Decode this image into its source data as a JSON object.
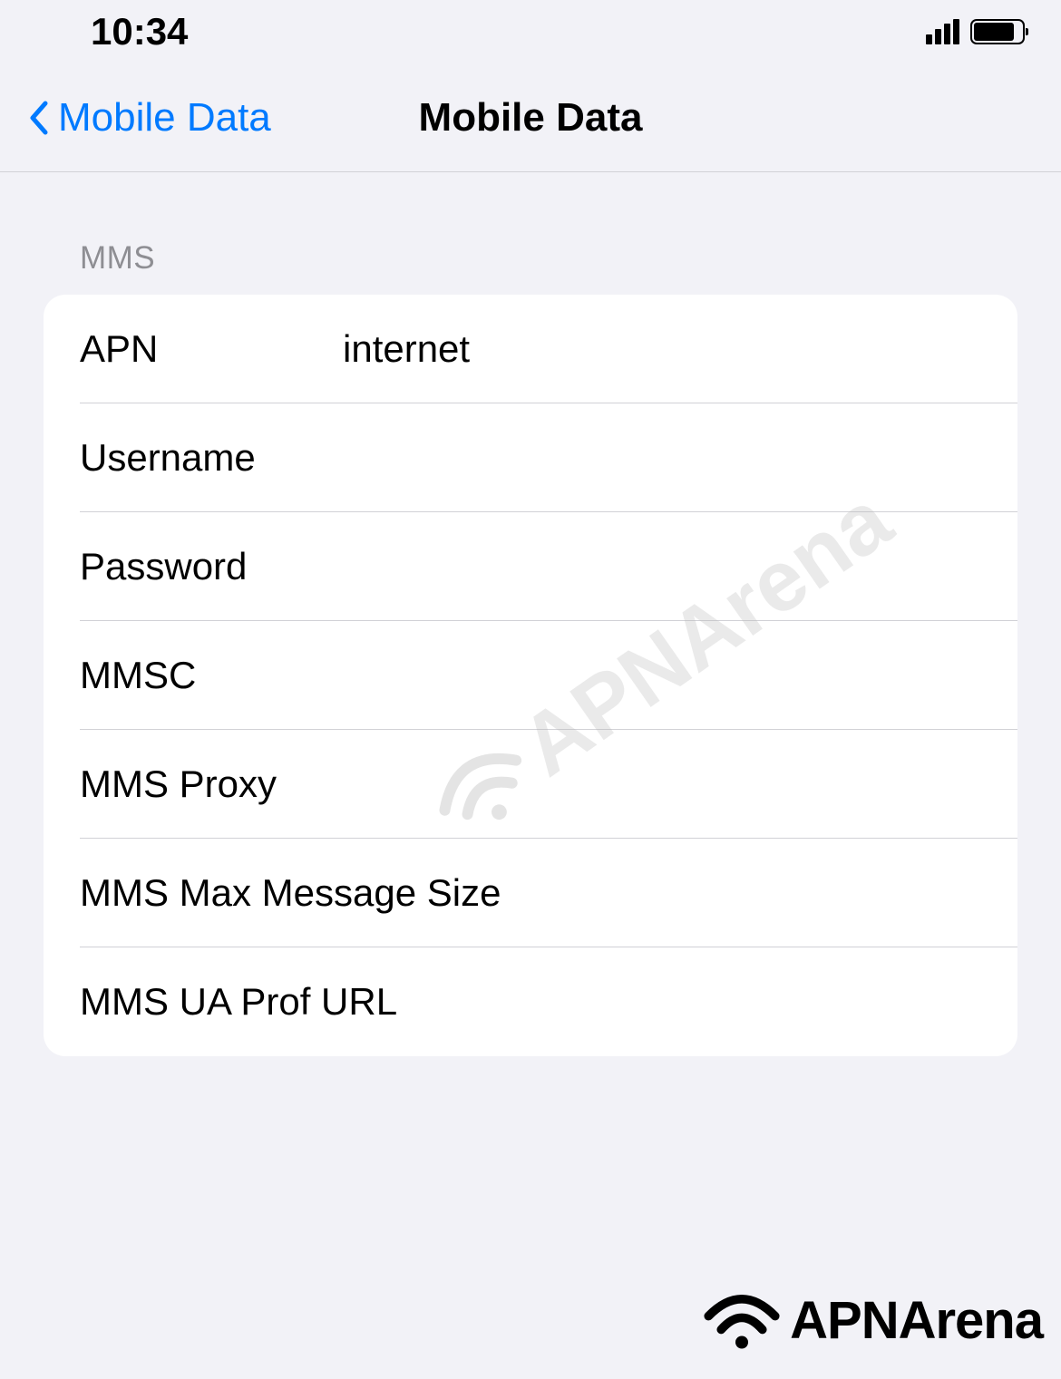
{
  "status_bar": {
    "time": "10:34"
  },
  "nav": {
    "back_label": "Mobile Data",
    "title": "Mobile Data"
  },
  "section": {
    "header": "MMS"
  },
  "fields": {
    "apn": {
      "label": "APN",
      "value": "internet"
    },
    "username": {
      "label": "Username",
      "value": ""
    },
    "password": {
      "label": "Password",
      "value": ""
    },
    "mmsc": {
      "label": "MMSC",
      "value": ""
    },
    "mms_proxy": {
      "label": "MMS Proxy",
      "value": ""
    },
    "mms_max_size": {
      "label": "MMS Max Message Size",
      "value": ""
    },
    "mms_ua_prof": {
      "label": "MMS UA Prof URL",
      "value": ""
    }
  },
  "watermark": {
    "text": "APNArena"
  },
  "footer": {
    "text": "APNArena"
  }
}
